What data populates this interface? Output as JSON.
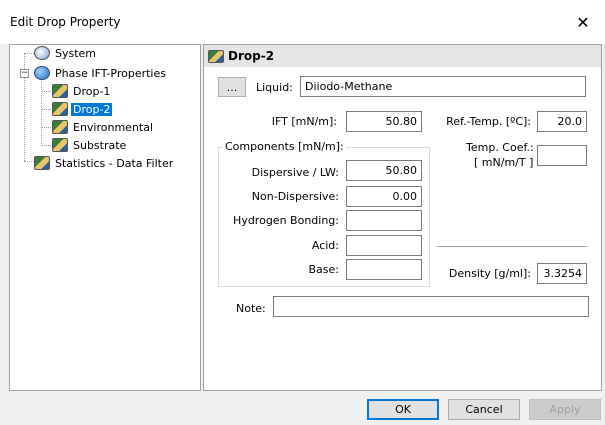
{
  "window": {
    "title": "Edit Drop Property",
    "close_glyph": "✕"
  },
  "tree": {
    "items": [
      {
        "label": "System",
        "icon": "gear-icon"
      },
      {
        "label": "Phase IFT-Properties",
        "icon": "globe-icon"
      },
      {
        "label": "Drop-1",
        "icon": "gear-icon"
      },
      {
        "label": "Drop-2",
        "icon": "gear-icon",
        "selected": true
      },
      {
        "label": "Environmental",
        "icon": "gear-icon"
      },
      {
        "label": "Substrate",
        "icon": "gear-icon"
      },
      {
        "label": "Statistics - Data Filter",
        "icon": "gear-icon"
      }
    ],
    "expander_glyph": "−"
  },
  "panel": {
    "title": "Drop-2",
    "browse_label": "...",
    "liquid_label": "Liquid:",
    "liquid_value": "Diiodo-Methane",
    "ift_label": "IFT [mN/m]:",
    "ift_value": "50.80",
    "ref_temp_label": "Ref.-Temp. [ºC]:",
    "ref_temp_value": "20.0",
    "components_title": "Components [mN/m]:",
    "dispersive_label": "Dispersive / LW:",
    "dispersive_value": "50.80",
    "non_dispersive_label": "Non-Dispersive:",
    "non_dispersive_value": "0.00",
    "hydrogen_label": "Hydrogen Bonding:",
    "hydrogen_value": "",
    "acid_label": "Acid:",
    "acid_value": "",
    "base_label": "Base:",
    "base_value": "",
    "temp_coef_label_1": "Temp. Coef.:",
    "temp_coef_label_2": "[ mN/m/T ]",
    "temp_coef_value": "",
    "density_label": "Density [g/ml]:",
    "density_value": "3.3254",
    "note_label": "Note:",
    "note_value": ""
  },
  "buttons": {
    "ok": "OK",
    "cancel": "Cancel",
    "apply": "Apply"
  },
  "colors": {
    "selection": "#0078d7",
    "dialog_bg": "#f0f0f0"
  }
}
